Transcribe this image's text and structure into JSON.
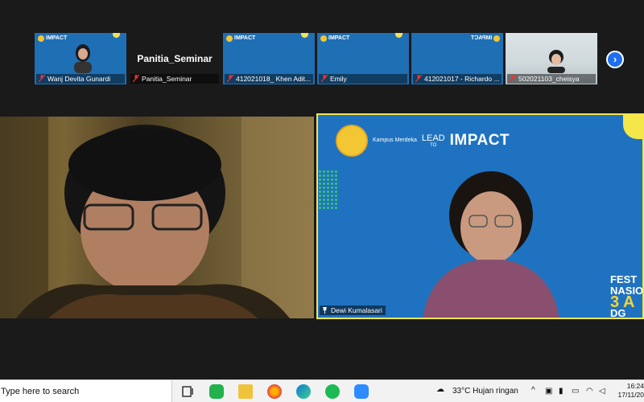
{
  "meeting": {
    "thumbnails": [
      {
        "name": "Wanj Devita Gunardi",
        "type": "video"
      },
      {
        "name": "Panitia_Seminar",
        "type": "plain",
        "big": "Panitia_Seminar"
      },
      {
        "name": "412021018_ Khen Adit...",
        "type": "video"
      },
      {
        "name": "Emily",
        "type": "video"
      },
      {
        "name": "412021017 - Richardo ...",
        "type": "video"
      },
      {
        "name": "502021103_cheisya",
        "type": "photo"
      }
    ],
    "slide_brand": {
      "kampus": "Kampus Merdeka",
      "lead": "LEAD",
      "to": "TO",
      "impact": "IMPACT",
      "festival": [
        "FEST",
        "NASIO"
      ],
      "big3": "3 A",
      "dg": "DG"
    },
    "speaker_name": "Dewi Kumalasari"
  },
  "taskbar": {
    "search_placeholder": "Type here to search",
    "weather": "33°C  Hujan ringan",
    "time": "16:24",
    "date": "17/11/20"
  },
  "colors": {
    "zoom_blue": "#1f72c0",
    "highlight": "#f5e64a",
    "accent": "#1e6ff0"
  }
}
